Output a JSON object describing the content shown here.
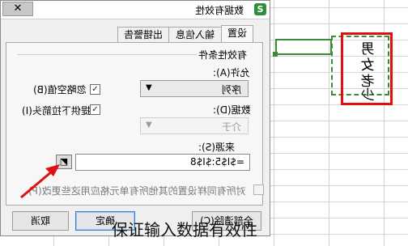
{
  "dialog": {
    "title": "数据有效性",
    "app_icon": "S",
    "close_symbol": "✕",
    "tabs": [
      {
        "label": "设置"
      },
      {
        "label": "输入信息"
      },
      {
        "label": "出错警告"
      }
    ],
    "group_title": "有效性条件",
    "allow_label": "允许(A):",
    "allow_value": "序列",
    "ignore_blank_label": "忽略空值(B)",
    "dropdown_label": "提供下拉箭头(I)",
    "data_label": "数据(D):",
    "data_value": "介于",
    "source_label": "来源(S):",
    "source_value": "=$I$5:$I$8",
    "apply_all_label": "对所有同样设置的其他所有单元格应用这些更改(P)",
    "buttons": {
      "clear_all": "全部清除(C)",
      "ok": "确定",
      "cancel": "取消"
    },
    "check_mark": "✓"
  },
  "sheet": {
    "source_cells": [
      "男",
      "女",
      "老",
      "少"
    ]
  },
  "caption": "保证输入数据有效性",
  "colors": {
    "selection_green": "#3a8a3a",
    "annotation_red": "#e01010"
  }
}
